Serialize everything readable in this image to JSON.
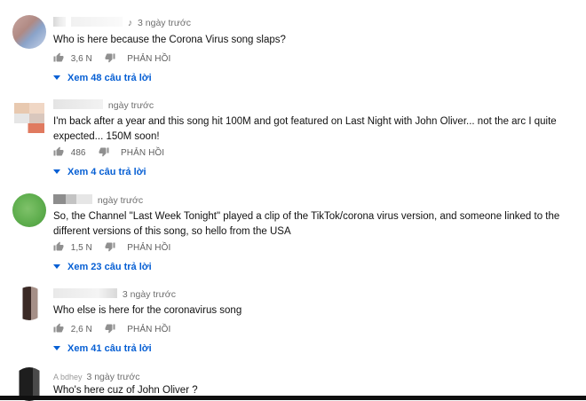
{
  "comments": [
    {
      "time": "3 ngày trước",
      "text": "Who is here because the Corona Virus song slaps?",
      "likes": "3,6 N",
      "reply": "PHẢN HỒI",
      "replies": "Xem 48 câu trả lời"
    },
    {
      "time": "ngày trước",
      "text": "I'm back after a year and this song hit 100M and got featured on Last Night with John Oliver... not the arc I quite expected... 150M soon!",
      "likes": "486",
      "reply": "PHẢN HỒI",
      "replies": "Xem 4 câu trả lời"
    },
    {
      "time": "ngày trước",
      "text": "So, the Channel \"Last Week Tonight\" played a clip of the TikTok/corona virus version, and someone linked to the different versions of this song, so hello from the USA",
      "likes": "1,5 N",
      "reply": "PHẢN HỒI",
      "replies": "Xem 23 câu trả lời"
    },
    {
      "time": "3 ngày trước",
      "text": "Who else is here for the coronavirus song",
      "likes": "2,6 N",
      "reply": "PHẢN HỒI",
      "replies": "Xem 41 câu trả lời"
    },
    {
      "author": "A bdhey",
      "time": "3 ngày trước",
      "text": "Who's here cuz of John Oliver ?"
    }
  ],
  "icons": {
    "like": "thumbs-up-icon",
    "dislike": "thumbs-down-icon",
    "expand": "chevron-down-icon",
    "music": "music-note-icon"
  },
  "colors": {
    "link": "#065fd4",
    "meta": "#6e6e6e",
    "text": "#111111"
  }
}
